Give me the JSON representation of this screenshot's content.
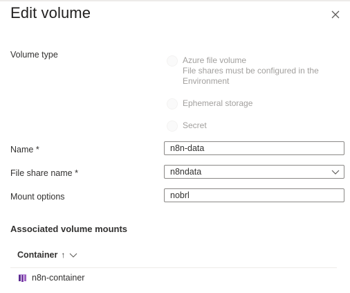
{
  "dialog": {
    "title": "Edit volume",
    "close_icon": "close-icon"
  },
  "volume_type": {
    "label": "Volume type",
    "options": [
      {
        "label": "Azure file volume",
        "description": "File shares must be configured in the Environment",
        "selected": false
      },
      {
        "label": "Ephemeral storage",
        "selected": false
      },
      {
        "label": "Secret",
        "selected": false
      }
    ]
  },
  "form": {
    "name": {
      "label": "Name *",
      "value": "n8n-data"
    },
    "file_share": {
      "label": "File share name *",
      "value": "n8ndata"
    },
    "mount_options": {
      "label": "Mount options",
      "value": "nobrl"
    }
  },
  "mounts": {
    "heading": "Associated volume mounts",
    "column_header": "Container",
    "sort_arrow": "↑",
    "rows": [
      {
        "name": "n8n-container",
        "icon": "container-icon"
      }
    ]
  },
  "colors": {
    "accent": "#7a3ea7",
    "border": "#8a8886",
    "disabled_text": "#a19f9d"
  }
}
